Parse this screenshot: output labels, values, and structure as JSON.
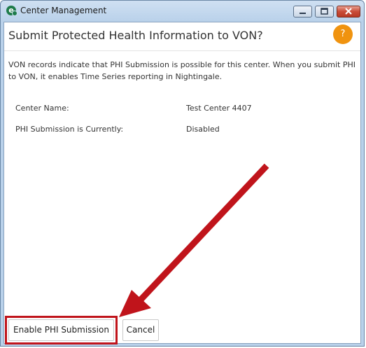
{
  "window": {
    "title": "Center Management",
    "app_icon": "center-management-icon",
    "controls": [
      "minimize-icon",
      "maximize-icon",
      "close-icon"
    ]
  },
  "dialog": {
    "heading": "Submit Protected Health Information to VON?",
    "help_label": "?",
    "description": "VON records indicate that PHI Submission is possible for this center.  When you submit PHI to VON, it enables Time Series reporting in Nightingale.",
    "fields": [
      {
        "label": "Center Name:",
        "value": "Test Center 4407"
      },
      {
        "label": "PHI Submission is Currently:",
        "value": "Disabled"
      }
    ]
  },
  "buttons": {
    "enable_label": "Enable PHI Submission",
    "cancel_label": "Cancel"
  },
  "annotation": {
    "arrow_color": "#c0141b",
    "highlight_color": "#c0141b"
  },
  "colors": {
    "help_accent": "#f0930f",
    "window_frame": "#b9d1ea"
  }
}
